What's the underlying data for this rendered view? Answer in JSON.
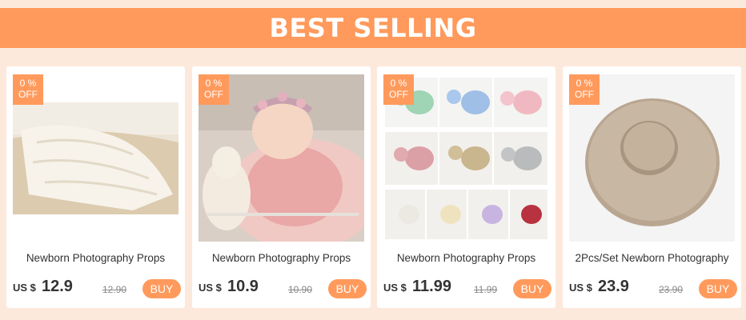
{
  "banner": {
    "title": "BEST SELLING"
  },
  "colors": {
    "accent": "#ff9a5c",
    "page_bg": "#fde9dc"
  },
  "products": [
    {
      "discount_top": "0 %",
      "discount_bottom": "OFF",
      "name": "Newborn Photography Props",
      "currency": "US $",
      "price": "12.9",
      "old_price": "12.90",
      "buy_label": "BUY",
      "image": "cream-lace-wrap"
    },
    {
      "discount_top": "0 %",
      "discount_bottom": "OFF",
      "name": "Newborn Photography Props",
      "currency": "US $",
      "price": "10.9",
      "old_price": "10.90",
      "buy_label": "BUY",
      "image": "newborn-baby-pink-wrap"
    },
    {
      "discount_top": "0 %",
      "discount_bottom": "OFF",
      "name": "Newborn Photography Props",
      "currency": "US $",
      "price": "11.99",
      "old_price": "11.99",
      "buy_label": "BUY",
      "image": "pillow-bonnet-set-grid"
    },
    {
      "discount_top": "0 %",
      "discount_bottom": "OFF",
      "name": "2Pcs/Set Newborn Photography",
      "currency": "US $",
      "price": "23.9",
      "old_price": "23.90",
      "buy_label": "BUY",
      "image": "tan-posing-donut-pillow"
    }
  ]
}
